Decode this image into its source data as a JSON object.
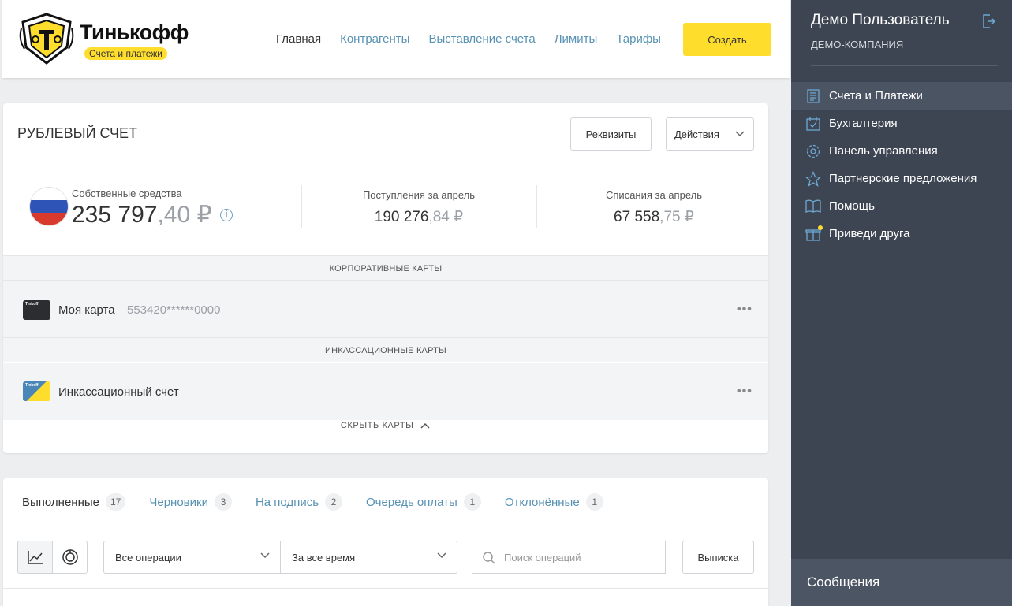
{
  "header": {
    "brand": "Тинькофф",
    "badge": "Счета и платежи",
    "nav": [
      "Главная",
      "Контрагенты",
      "Выставление счета",
      "Лимиты",
      "Тарифы"
    ],
    "create_label": "Создать"
  },
  "account": {
    "title": "РУБЛЕВЫЙ СЧЕТ",
    "details_label": "Реквизиты",
    "actions_label": "Действия",
    "own_funds_label": "Собственные средства",
    "own_funds_whole": "235 797",
    "own_funds_cents": ",40 ₽",
    "income_label": "Поступления за апрель",
    "income_whole": "190 276",
    "income_cents": ",84 ₽",
    "outgo_label": "Списания за апрель",
    "outgo_whole": "67 558",
    "outgo_cents": ",75 ₽",
    "corporate_section": "КОРПОРАТИВНЫЕ КАРТЫ",
    "card1_name": "Моя карта",
    "card1_number": "553420******0000",
    "collection_section": "ИНКАССАЦИОННЫЕ КАРТЫ",
    "card2_name": "Инкассационный счет",
    "hide_cards": "СКРЫТЬ КАРТЫ",
    "card_thumb_text": "Tinkoff"
  },
  "operations": {
    "tabs": [
      {
        "label": "Выполненные",
        "count": "17"
      },
      {
        "label": "Черновики",
        "count": "3"
      },
      {
        "label": "На подпись",
        "count": "2"
      },
      {
        "label": "Очередь оплаты",
        "count": "1"
      },
      {
        "label": "Отклонённые",
        "count": "1"
      }
    ],
    "filter_type": "Все операции",
    "filter_period": "За все время",
    "search_placeholder": "Поиск операций",
    "statement_label": "Выписка"
  },
  "sidebar": {
    "user_name": "Демо Пользователь",
    "company": "ДЕМО-КОМПАНИЯ",
    "items": [
      {
        "label": "Счета и Платежи",
        "icon": "document-icon"
      },
      {
        "label": "Бухгалтерия",
        "icon": "calendar-check-icon"
      },
      {
        "label": "Панель управления",
        "icon": "gear-icon"
      },
      {
        "label": "Партнерские предложения",
        "icon": "star-icon"
      },
      {
        "label": "Помощь",
        "icon": "book-icon"
      },
      {
        "label": "Приведи друга",
        "icon": "gift-icon"
      }
    ],
    "messages": "Сообщения"
  },
  "colors": {
    "accent_yellow": "#ffdd2d",
    "link_blue": "#5792b3",
    "sidebar_bg": "#3d4552"
  }
}
